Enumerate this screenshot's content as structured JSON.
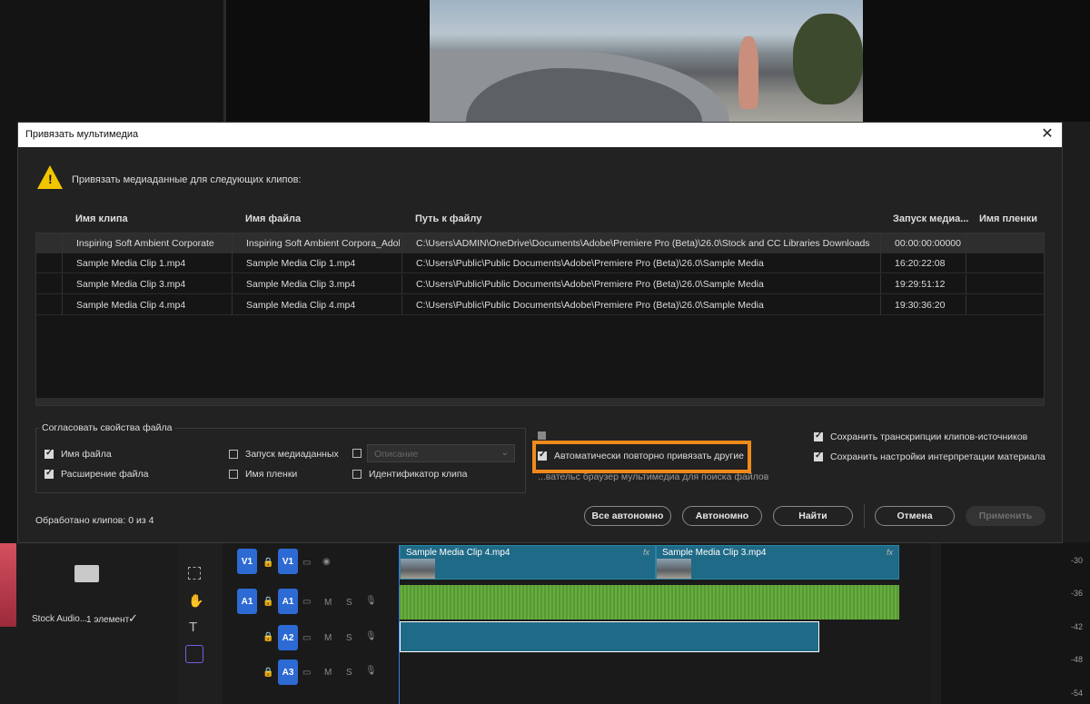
{
  "dialog": {
    "title": "Привязать мультимедиа",
    "message": "Привязать медиаданные для следующих клипов:",
    "columns": [
      "Имя клипа",
      "Имя файла",
      "Путь к файлу",
      "Запуск медиа...",
      "Имя пленки"
    ],
    "rows": [
      {
        "clip": "Inspiring Soft Ambient Corporate",
        "file": "Inspiring Soft Ambient Corpora_Adobe",
        "path": "C:\\Users\\ADMIN\\OneDrive\\Documents\\Adobe\\Premiere Pro (Beta)\\26.0\\Stock and CC Libraries Downloads",
        "start": "00:00:00:00000",
        "tape": ""
      },
      {
        "clip": "Sample Media Clip 1.mp4",
        "file": "Sample Media Clip 1.mp4",
        "path": "C:\\Users\\Public\\Public Documents\\Adobe\\Premiere Pro (Beta)\\26.0\\Sample Media",
        "start": "16:20:22:08",
        "tape": ""
      },
      {
        "clip": "Sample Media Clip 3.mp4",
        "file": "Sample Media Clip 3.mp4",
        "path": "C:\\Users\\Public\\Public Documents\\Adobe\\Premiere Pro (Beta)\\26.0\\Sample Media",
        "start": "19:29:51:12",
        "tape": ""
      },
      {
        "clip": "Sample Media Clip 4.mp4",
        "file": "Sample Media Clip 4.mp4",
        "path": "C:\\Users\\Public\\Public Documents\\Adobe\\Premiere Pro (Beta)\\26.0\\Sample Media",
        "start": "19:30:36:20",
        "tape": ""
      }
    ],
    "match_group_title": "Согласовать свойства файла",
    "match_options": {
      "file_name": "Имя файла",
      "file_extension": "Расширение файла",
      "media_start": "Запуск медиаданных",
      "tape_name": "Имя пленки",
      "description": "Описание",
      "clip_id": "Идентификатор клипа"
    },
    "options": {
      "auto_relink": "Автоматически повторно привязать другие",
      "partial_bottom": "...вательс браузер мультимедиа для поиска файлов",
      "keep_transcripts": "Сохранить транскрипции клипов-источников",
      "keep_interpretation": "Сохранить настройки интерпретации материала"
    },
    "status": "Обработано клипов: 0 из 4",
    "buttons": {
      "offline_all": "Все автономно",
      "offline": "Автономно",
      "find": "Найти",
      "cancel": "Отмена",
      "apply": "Применить"
    },
    "close_glyph": "✕",
    "warning_glyph": "!"
  },
  "timeline": {
    "tracks": {
      "v1_src": "V1",
      "v1": "V1",
      "a1_src": "A1",
      "a1": "A1",
      "a2": "A2",
      "a3": "A3"
    },
    "clips": {
      "v_clip4": "Sample Media Clip 4.mp4",
      "v_clip3": "Sample Media Clip 3.mp4"
    },
    "fx": "fx",
    "m": "M",
    "s": "S",
    "meter": [
      "-30",
      "-36",
      "-42",
      "-48",
      "-54"
    ]
  },
  "project": {
    "bin_name": "Stock Audio...",
    "bin_count": "1 элемент"
  },
  "colors": {
    "accent": "#f08a1c",
    "track_blue": "#2d6ad4",
    "video_clip": "#1f6a86",
    "audio_clip": "#4f8d2e"
  }
}
